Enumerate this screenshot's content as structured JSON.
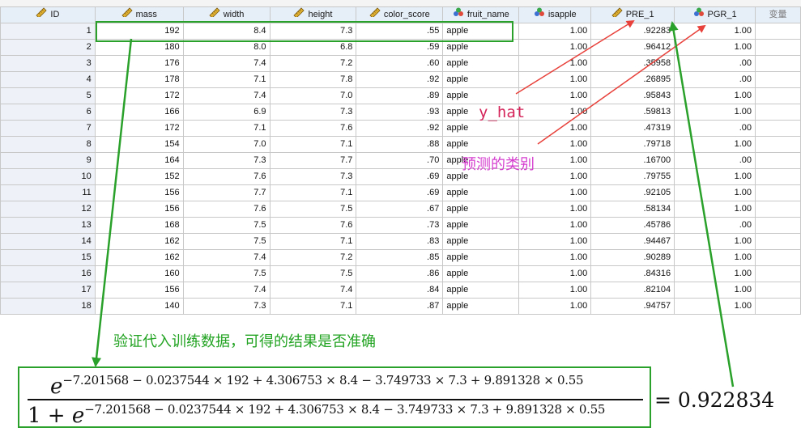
{
  "columns": [
    {
      "key": "id",
      "label": "ID",
      "icon": "ruler-icon"
    },
    {
      "key": "mass",
      "label": "mass",
      "icon": "ruler-icon"
    },
    {
      "key": "width",
      "label": "width",
      "icon": "ruler-icon"
    },
    {
      "key": "height",
      "label": "height",
      "icon": "ruler-icon"
    },
    {
      "key": "color_score",
      "label": "color_score",
      "icon": "ruler-icon"
    },
    {
      "key": "fruit_name",
      "label": "fruit_name",
      "icon": "nominal-icon"
    },
    {
      "key": "isapple",
      "label": "isapple",
      "icon": "nominal-icon"
    },
    {
      "key": "pre",
      "label": "PRE_1",
      "icon": "ruler-icon"
    },
    {
      "key": "pgr",
      "label": "PGR_1",
      "icon": "nominal-icon"
    },
    {
      "key": "var",
      "label": "变量",
      "icon": ""
    }
  ],
  "rows": [
    {
      "id": "1",
      "mass": "192",
      "width": "8.4",
      "height": "7.3",
      "color_score": ".55",
      "fruit_name": "apple",
      "isapple": "1.00",
      "pre": ".92283",
      "pgr": "1.00"
    },
    {
      "id": "2",
      "mass": "180",
      "width": "8.0",
      "height": "6.8",
      "color_score": ".59",
      "fruit_name": "apple",
      "isapple": "1.00",
      "pre": ".96412",
      "pgr": "1.00"
    },
    {
      "id": "3",
      "mass": "176",
      "width": "7.4",
      "height": "7.2",
      "color_score": ".60",
      "fruit_name": "apple",
      "isapple": "1.00",
      "pre": ".35958",
      "pgr": ".00"
    },
    {
      "id": "4",
      "mass": "178",
      "width": "7.1",
      "height": "7.8",
      "color_score": ".92",
      "fruit_name": "apple",
      "isapple": "1.00",
      "pre": ".26895",
      "pgr": ".00"
    },
    {
      "id": "5",
      "mass": "172",
      "width": "7.4",
      "height": "7.0",
      "color_score": ".89",
      "fruit_name": "apple",
      "isapple": "1.00",
      "pre": ".95843",
      "pgr": "1.00"
    },
    {
      "id": "6",
      "mass": "166",
      "width": "6.9",
      "height": "7.3",
      "color_score": ".93",
      "fruit_name": "apple",
      "isapple": "1.00",
      "pre": ".59813",
      "pgr": "1.00"
    },
    {
      "id": "7",
      "mass": "172",
      "width": "7.1",
      "height": "7.6",
      "color_score": ".92",
      "fruit_name": "apple",
      "isapple": "1.00",
      "pre": ".47319",
      "pgr": ".00"
    },
    {
      "id": "8",
      "mass": "154",
      "width": "7.0",
      "height": "7.1",
      "color_score": ".88",
      "fruit_name": "apple",
      "isapple": "1.00",
      "pre": ".79718",
      "pgr": "1.00"
    },
    {
      "id": "9",
      "mass": "164",
      "width": "7.3",
      "height": "7.7",
      "color_score": ".70",
      "fruit_name": "apple",
      "isapple": "1.00",
      "pre": ".16700",
      "pgr": ".00"
    },
    {
      "id": "10",
      "mass": "152",
      "width": "7.6",
      "height": "7.3",
      "color_score": ".69",
      "fruit_name": "apple",
      "isapple": "1.00",
      "pre": ".79755",
      "pgr": "1.00"
    },
    {
      "id": "11",
      "mass": "156",
      "width": "7.7",
      "height": "7.1",
      "color_score": ".69",
      "fruit_name": "apple",
      "isapple": "1.00",
      "pre": ".92105",
      "pgr": "1.00"
    },
    {
      "id": "12",
      "mass": "156",
      "width": "7.6",
      "height": "7.5",
      "color_score": ".67",
      "fruit_name": "apple",
      "isapple": "1.00",
      "pre": ".58134",
      "pgr": "1.00"
    },
    {
      "id": "13",
      "mass": "168",
      "width": "7.5",
      "height": "7.6",
      "color_score": ".73",
      "fruit_name": "apple",
      "isapple": "1.00",
      "pre": ".45786",
      "pgr": ".00"
    },
    {
      "id": "14",
      "mass": "162",
      "width": "7.5",
      "height": "7.1",
      "color_score": ".83",
      "fruit_name": "apple",
      "isapple": "1.00",
      "pre": ".94467",
      "pgr": "1.00"
    },
    {
      "id": "15",
      "mass": "162",
      "width": "7.4",
      "height": "7.2",
      "color_score": ".85",
      "fruit_name": "apple",
      "isapple": "1.00",
      "pre": ".90289",
      "pgr": "1.00"
    },
    {
      "id": "16",
      "mass": "160",
      "width": "7.5",
      "height": "7.5",
      "color_score": ".86",
      "fruit_name": "apple",
      "isapple": "1.00",
      "pre": ".84316",
      "pgr": "1.00"
    },
    {
      "id": "17",
      "mass": "156",
      "width": "7.4",
      "height": "7.4",
      "color_score": ".84",
      "fruit_name": "apple",
      "isapple": "1.00",
      "pre": ".82104",
      "pgr": "1.00"
    },
    {
      "id": "18",
      "mass": "140",
      "width": "7.3",
      "height": "7.1",
      "color_score": ".87",
      "fruit_name": "apple",
      "isapple": "1.00",
      "pre": ".94757",
      "pgr": "1.00"
    }
  ],
  "annotations": {
    "y_hat": "y_hat",
    "predicted_class": "预测的类别",
    "verify_text": "验证代入训练数据，可得的结果是否准确"
  },
  "formula": {
    "base": "e",
    "exponent": "−7.201568 − 0.0237544 × 192 + 4.306753 × 8.4 − 3.749733 × 7.3 + 9.891328 × 0.55",
    "den_prefix": "1 + ",
    "result": "= 0.922834"
  },
  "colors": {
    "green": "#2aa12a",
    "red": "#e8413b",
    "pink": "#d53ecf",
    "header_bg": "#e6eef8"
  }
}
